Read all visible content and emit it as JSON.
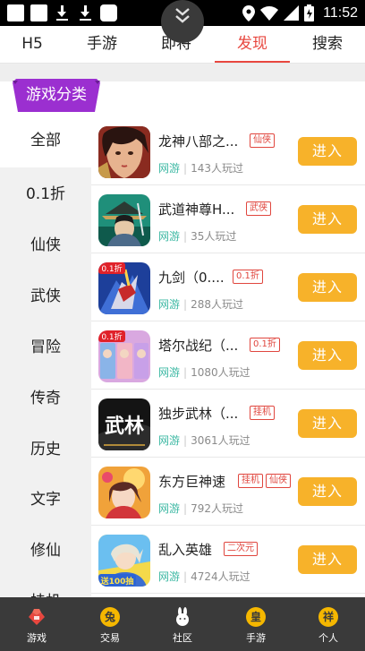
{
  "status_bar": {
    "time": "11:52"
  },
  "top_tabs": [
    {
      "label": "H5"
    },
    {
      "label": "手游"
    },
    {
      "label": "即将"
    },
    {
      "label": "发现"
    },
    {
      "label": "搜索"
    }
  ],
  "active_tab": "发现",
  "category_badge": "游戏分类",
  "sidebar": {
    "items": [
      {
        "label": "全部"
      },
      {
        "label": "0.1折"
      },
      {
        "label": "仙侠"
      },
      {
        "label": "武侠"
      },
      {
        "label": "冒险"
      },
      {
        "label": "传奇"
      },
      {
        "label": "历史"
      },
      {
        "label": "文字"
      },
      {
        "label": "修仙"
      },
      {
        "label": "挂机"
      }
    ],
    "active": "全部"
  },
  "games": [
    {
      "title": "龙神八部之...",
      "tags": [
        "仙侠"
      ],
      "genre": "网游",
      "players": "143人玩过",
      "button": "进入"
    },
    {
      "title": "武道神尊H...",
      "tags": [
        "武侠"
      ],
      "genre": "网游",
      "players": "35人玩过",
      "button": "进入"
    },
    {
      "title": "九剑（0....",
      "tags": [
        "0.1折"
      ],
      "genre": "网游",
      "players": "288人玩过",
      "button": "进入"
    },
    {
      "title": "塔尔战纪（...",
      "tags": [
        "0.1折"
      ],
      "genre": "网游",
      "players": "1080人玩过",
      "button": "进入"
    },
    {
      "title": "独步武林（...",
      "tags": [
        "挂机"
      ],
      "genre": "网游",
      "players": "3061人玩过",
      "button": "进入"
    },
    {
      "title": "东方巨神速",
      "tags": [
        "挂机",
        "仙侠"
      ],
      "genre": "网游",
      "players": "792人玩过",
      "button": "进入"
    },
    {
      "title": "乱入英雄",
      "tags": [
        "二次元"
      ],
      "genre": "网游",
      "players": "4724人玩过",
      "button": "进入"
    }
  ],
  "icon_badges": {
    "jiujian": "0.1折",
    "taer": "0.1折",
    "dubu": "武林",
    "luanru": "送100抽"
  },
  "bottom_nav": [
    {
      "label": "游戏",
      "icon": "game-icon",
      "glyph": ""
    },
    {
      "label": "交易",
      "icon": "rabbit-coin-icon",
      "glyph": "兔"
    },
    {
      "label": "社区",
      "icon": "rabbit-icon",
      "glyph": ""
    },
    {
      "label": "手游",
      "icon": "emperor-coin-icon",
      "glyph": "皇"
    },
    {
      "label": "个人",
      "icon": "lucky-coin-icon",
      "glyph": "祥"
    }
  ],
  "colors": {
    "accent_red": "#e8473f",
    "tag_red": "#e0463e",
    "button_yellow": "#f7b22a",
    "badge_purple": "#9b2fd0",
    "genre_teal": "#3cb8a3",
    "nav_bg": "#3a3a3a"
  }
}
